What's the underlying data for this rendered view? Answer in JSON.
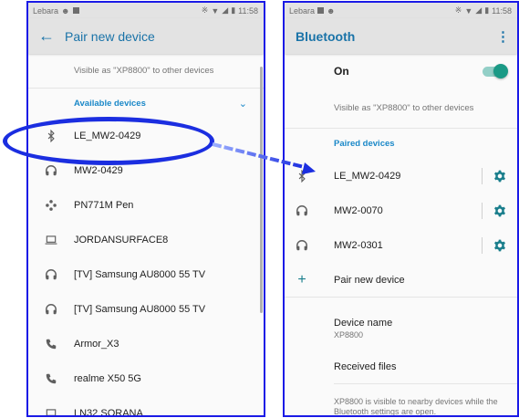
{
  "left_screen": {
    "status": {
      "carrier": "Lebara",
      "time": "11:58"
    },
    "appbar": {
      "back_glyph": "←",
      "title": "Pair new device"
    },
    "visible_as": "Visible as \"XP8800\" to other devices",
    "section_title": "Available devices",
    "section_chevron": "⌄",
    "devices": [
      {
        "name": "LE_MW2-0429",
        "icon": "bluetooth-icon"
      },
      {
        "name": "MW2-0429",
        "icon": "headphones-icon"
      },
      {
        "name": "PN771M Pen",
        "icon": "pen-icon"
      },
      {
        "name": "JORDANSURFACE8",
        "icon": "laptop-icon"
      },
      {
        "name": "[TV] Samsung AU8000 55 TV",
        "icon": "headphones-icon"
      },
      {
        "name": "[TV] Samsung AU8000 55 TV",
        "icon": "headphones-icon"
      },
      {
        "name": "Armor_X3",
        "icon": "phone-icon"
      },
      {
        "name": "realme X50 5G",
        "icon": "phone-icon"
      },
      {
        "name": "LN32 SORANA",
        "icon": "laptop-icon"
      }
    ]
  },
  "right_screen": {
    "status": {
      "carrier": "Lebara",
      "time": "11:58"
    },
    "appbar": {
      "title": "Bluetooth",
      "menu_glyph": "⋮"
    },
    "toggle_label": "On",
    "toggle_state": true,
    "visible_as": "Visible as \"XP8800\" to other devices",
    "section_title": "Paired devices",
    "paired": [
      {
        "name": "LE_MW2-0429",
        "icon": "bluetooth-icon"
      },
      {
        "name": "MW2-0070",
        "icon": "headphones-icon"
      },
      {
        "name": "MW2-0301",
        "icon": "headphones-icon"
      }
    ],
    "pair_new": {
      "glyph": "+",
      "label": "Pair new device"
    },
    "device_name": {
      "label": "Device name",
      "value": "XP8800"
    },
    "received_files": "Received files",
    "footnote": "XP8800 is visible to nearby devices while the Bluetooth settings are open."
  },
  "colors": {
    "accent": "#1a73a8",
    "annotation": "#1b2ee0",
    "toggle": "#1b9a86"
  }
}
